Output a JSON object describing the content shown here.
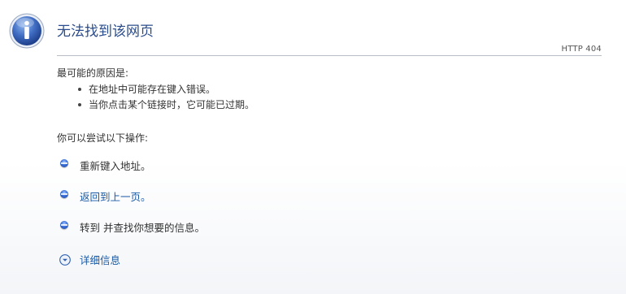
{
  "page": {
    "title": "无法找到该网页",
    "http_code": "HTTP 404",
    "icons": {
      "header": "info-icon",
      "bullet": "blue-orb-bullet-icon",
      "details_toggle": "chevron-down-circle-icon"
    },
    "colors": {
      "title": "#2a4c8c",
      "link": "#1a5aa6",
      "text": "#333333",
      "rule": "#b8bcc4"
    }
  },
  "reasons": {
    "heading": "最可能的原因是:",
    "items": [
      "在地址中可能存在键入错误。",
      "当你点击某个链接时，它可能已过期。"
    ]
  },
  "actions": {
    "heading": "你可以尝试以下操作:",
    "retype": "重新键入地址。",
    "go_back": "返回到上一页。",
    "search": "转到  并查找你想要的信息。"
  },
  "details": {
    "label": "详细信息"
  }
}
